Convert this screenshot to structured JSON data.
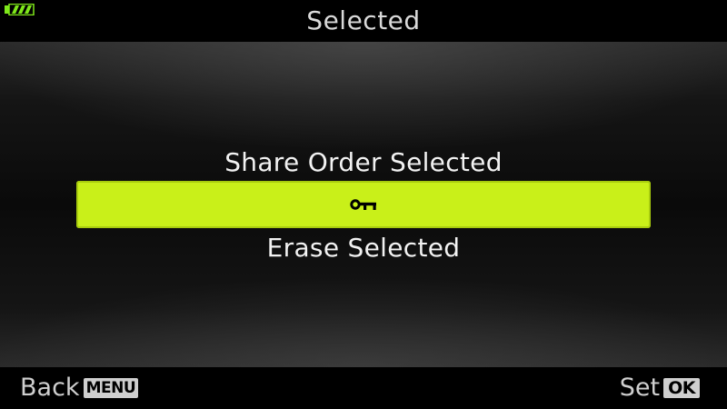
{
  "header": {
    "title": "Selected",
    "battery_icon": "battery-full-icon",
    "battery_color": "#7fe81a"
  },
  "menu": {
    "items": [
      {
        "label": "Share Order Selected"
      },
      {
        "label": "",
        "icon": "protect-key-icon",
        "selected": true
      },
      {
        "label": "Erase Selected"
      }
    ],
    "highlight_color": "#c9f019"
  },
  "footer": {
    "back_label": "Back",
    "back_badge": "MENU",
    "set_label": "Set",
    "set_badge": "OK"
  }
}
